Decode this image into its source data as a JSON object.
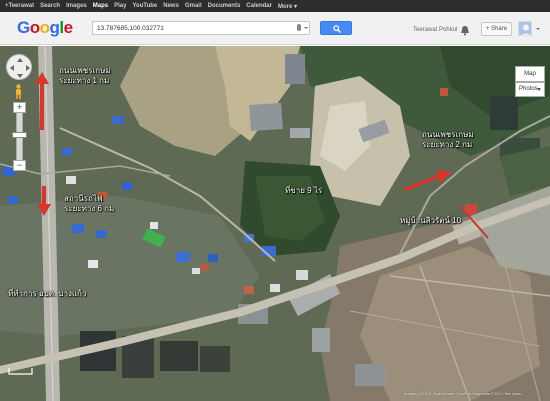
{
  "gbar": {
    "items": [
      "+Teerawat",
      "Search",
      "Images",
      "Maps",
      "Play",
      "YouTube",
      "News",
      "Gmail",
      "Documents",
      "Calendar",
      "More ▾"
    ],
    "active_index": 3
  },
  "header": {
    "logo_letters": [
      {
        "ch": "G",
        "color": "#3369e8"
      },
      {
        "ch": "o",
        "color": "#d50f25"
      },
      {
        "ch": "o",
        "color": "#eeb211"
      },
      {
        "ch": "g",
        "color": "#3369e8"
      },
      {
        "ch": "l",
        "color": "#009925"
      },
      {
        "ch": "e",
        "color": "#d50f25"
      }
    ],
    "search_value": "13.787685,100.032771",
    "user_name": "Teerawat Pohkul",
    "share_label": "+ Share",
    "icons": [
      "search-icon",
      "microphone-icon",
      "notification-bell-icon",
      "avatar"
    ]
  },
  "map": {
    "labels": [
      {
        "id": "label-phetkasem-1km",
        "lines": [
          "ถนนเพชรเกษม",
          "ระยะทาง 1 กม"
        ]
      },
      {
        "id": "label-railway-6km",
        "lines": [
          "สถานีรถไฟ",
          "ระยะทาง 6 กม"
        ]
      },
      {
        "id": "label-district-office",
        "lines": [
          "ที่ทำการ อบต. บางแก้ว"
        ]
      },
      {
        "id": "label-phetkasem-2km",
        "lines": [
          "ถนนเพชรเกษม",
          "ระยะทาง 2 กม"
        ]
      },
      {
        "id": "label-for-sale",
        "lines": [
          "ที่ขาย 9 ไร่"
        ]
      },
      {
        "id": "label-village",
        "lines": [
          "หมู่บ้านสิวรัตน์ 10"
        ]
      }
    ],
    "map_type_label": "Map",
    "photos_label": "Photos",
    "copyright": "Imagery ©2012 DigitalGlobe, GeoEye, Map data ©2012 Tele Atlas",
    "zoom_in": "+",
    "zoom_out": "−",
    "accent_arrow_color": "#d9352a",
    "icons": [
      "pan-control-icon",
      "pegman-icon",
      "zoom-slider",
      "scale-bar"
    ]
  }
}
